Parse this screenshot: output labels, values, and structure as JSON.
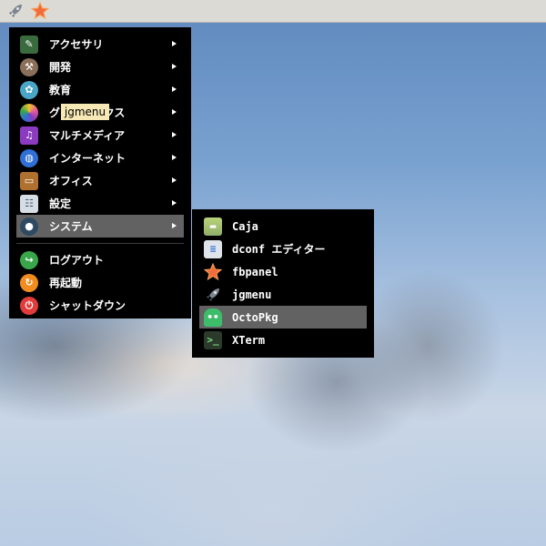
{
  "taskbar": {
    "buttons": [
      {
        "icon": "rocket-icon"
      },
      {
        "icon": "star-icon"
      }
    ]
  },
  "main_menu": {
    "items": [
      {
        "label": "アクセサリ",
        "icon": "accessories-icon",
        "color": "#3a6b3e",
        "has_submenu": true
      },
      {
        "label": "開発",
        "icon": "development-icon",
        "color": "#8a6f5a",
        "has_submenu": true
      },
      {
        "label": "教育",
        "icon": "education-icon",
        "color": "#4aa6c7",
        "has_submenu": true
      },
      {
        "label": "グラフィックス",
        "icon": "graphics-icon",
        "color": "#e25c9b",
        "has_submenu": true
      },
      {
        "label": "マルチメディア",
        "icon": "multimedia-icon",
        "color": "#8a3bbf",
        "has_submenu": true
      },
      {
        "label": "インターネット",
        "icon": "internet-icon",
        "color": "#2f6fd6",
        "has_submenu": true
      },
      {
        "label": "オフィス",
        "icon": "office-icon",
        "color": "#b0702f",
        "has_submenu": true
      },
      {
        "label": "設定",
        "icon": "settings-icon",
        "color": "#d6dde5",
        "has_submenu": true
      },
      {
        "label": "システム",
        "icon": "system-icon",
        "color": "#2e4a63",
        "has_submenu": true,
        "active": true
      }
    ],
    "session": [
      {
        "label": "ログアウト",
        "icon": "logout-icon",
        "color": "#3aa64b"
      },
      {
        "label": "再起動",
        "icon": "reboot-icon",
        "color": "#f28c1e"
      },
      {
        "label": "シャットダウン",
        "icon": "shutdown-icon",
        "color": "#e23b3b"
      }
    ]
  },
  "tooltip": {
    "text": "jgmenu"
  },
  "system_submenu": {
    "items": [
      {
        "label": "Caja",
        "icon": "file-manager-icon",
        "color": "#8fae6a"
      },
      {
        "label": "dconf エディター",
        "icon": "dconf-editor-icon",
        "color": "#dfe3ea"
      },
      {
        "label": "fbpanel",
        "icon": "star-icon",
        "color": "#f26b3a"
      },
      {
        "label": "jgmenu",
        "icon": "rocket-icon",
        "color": "#4a5560"
      },
      {
        "label": "OctoPkg",
        "icon": "octopkg-icon",
        "color": "#3dbd6a",
        "active": true
      },
      {
        "label": "XTerm",
        "icon": "terminal-icon",
        "color": "#2b3a2b"
      }
    ]
  }
}
